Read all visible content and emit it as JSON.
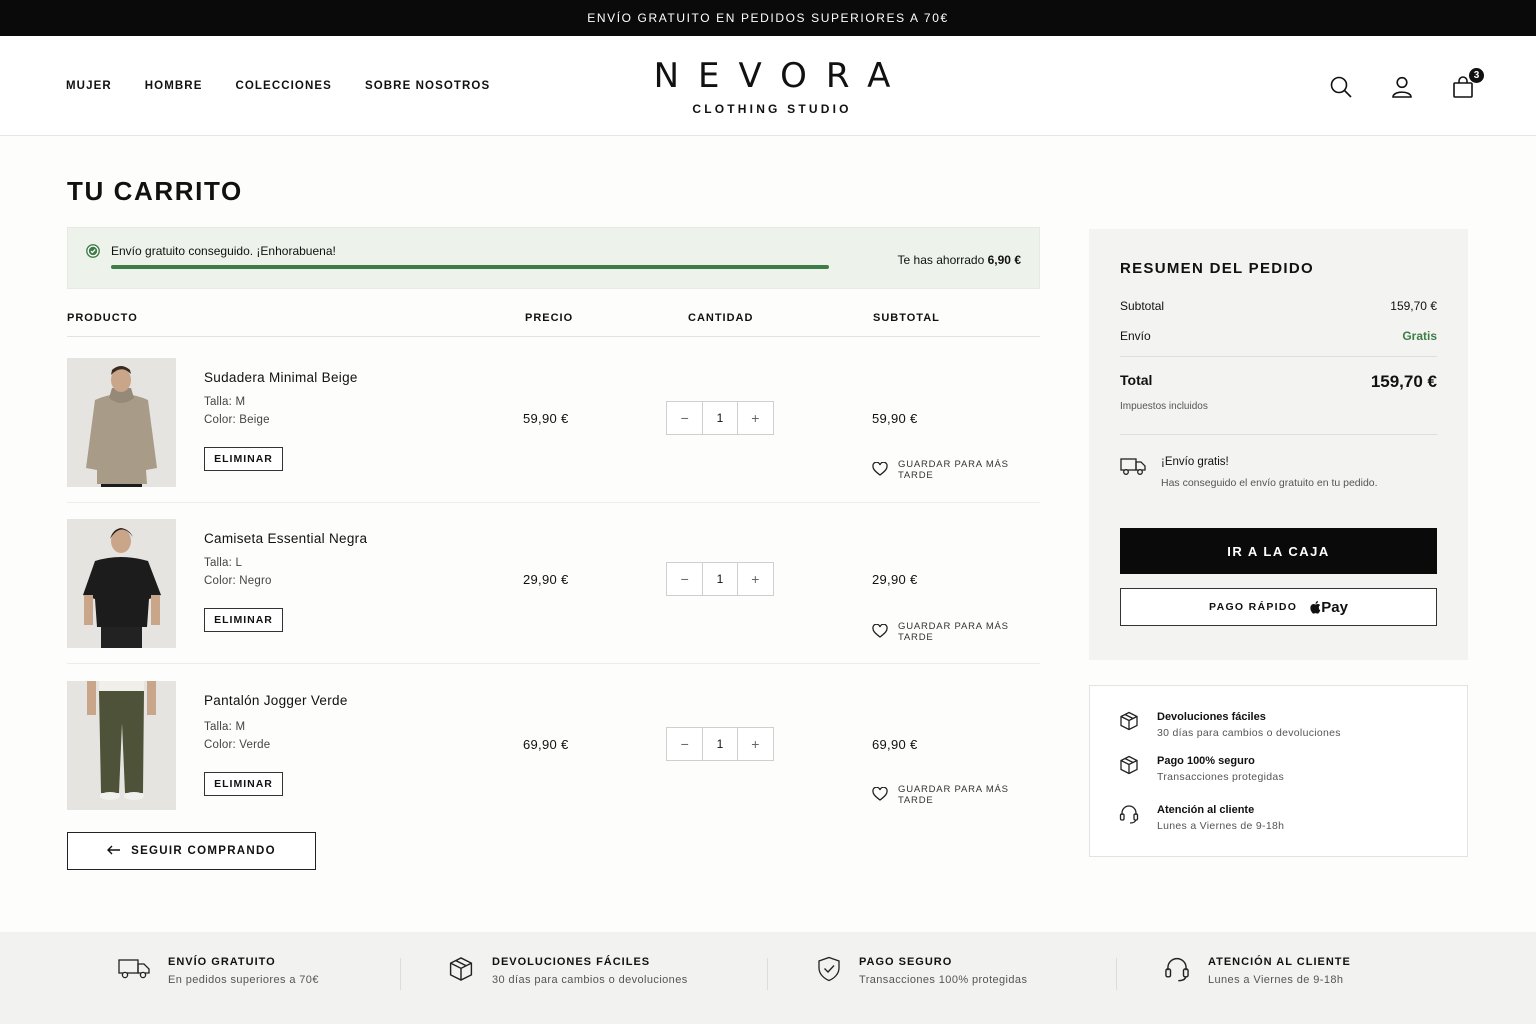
{
  "announcement": "ENVÍO GRATUITO EN PEDIDOS SUPERIORES A 70€",
  "nav": [
    "MUJER",
    "HOMBRE",
    "COLECCIONES",
    "SOBRE NOSOTROS"
  ],
  "brand": {
    "name": "NEVORA",
    "tagline": "CLOTHING STUDIO"
  },
  "header_icons": {
    "search": "search-icon",
    "account": "user-icon",
    "cart": "bag-icon",
    "cart_count": "3"
  },
  "page_title": "TU CARRITO",
  "shipping_banner": {
    "message": "Envío gratuito conseguido. ¡Enhorabuena!",
    "saved_label": "Te has ahorrado",
    "saved_amount": "6,90 €",
    "progress": 1.0
  },
  "table_headers": {
    "product": "PRODUCTO",
    "price": "PRECIO",
    "quantity": "CANTIDAD",
    "subtotal": "SUBTOTAL"
  },
  "items": [
    {
      "name": "Sudadera Minimal Beige",
      "size": "Talla: M",
      "color": "Color: Beige",
      "price": "59,90 €",
      "qty": "1",
      "subtotal": "59,90 €",
      "remove": "ELIMINAR",
      "save": "GUARDAR PARA MÁS TARDE",
      "garment": "#a89c88"
    },
    {
      "name": "Camiseta Essential Negra",
      "size": "Talla: L",
      "color": "Color: Negro",
      "price": "29,90 €",
      "qty": "1",
      "subtotal": "29,90 €",
      "remove": "ELIMINAR",
      "save": "GUARDAR PARA MÁS TARDE",
      "garment": "#1c1c1c"
    },
    {
      "name": "Pantalón Jogger Verde",
      "size": "Talla: M",
      "color": "Color: Verde",
      "price": "69,90 €",
      "qty": "1",
      "subtotal": "69,90 €",
      "remove": "ELIMINAR",
      "save": "GUARDAR PARA MÁS TARDE",
      "garment": "#4d5238"
    }
  ],
  "continue_shopping": "SEGUIR COMPRANDO",
  "summary": {
    "title": "RESUMEN DEL PEDIDO",
    "subtotal_label": "Subtotal",
    "subtotal_value": "159,70 €",
    "shipping_label": "Envío",
    "shipping_value": "Gratis",
    "total_label": "Total",
    "total_value": "159,70 €",
    "taxes_note": "Impuestos incluidos",
    "free_title": "¡Envío gratis!",
    "free_sub": "Has conseguido el envío gratuito en tu pedido.",
    "checkout": "IR A LA CAJA",
    "fast_pay": "PAGO RÁPIDO",
    "apple_pay": "Pay"
  },
  "benefits": [
    {
      "title": "Devoluciones fáciles",
      "sub": "30 días para cambios o devoluciones",
      "icon": "box-icon"
    },
    {
      "title": "Pago 100% seguro",
      "sub": "Transacciones protegidas",
      "icon": "box-icon"
    },
    {
      "title": "Atención al cliente",
      "sub": "Lunes a Viernes de 9-18h",
      "icon": "headset-icon"
    }
  ],
  "footer": [
    {
      "title": "ENVÍO GRATUITO",
      "sub": "En pedidos superiores a 70€",
      "icon": "truck-icon"
    },
    {
      "title": "DEVOLUCIONES FÁCILES",
      "sub": "30 días para cambios o devoluciones",
      "icon": "box-icon"
    },
    {
      "title": "PAGO SEGURO",
      "sub": "Transacciones 100% protegidas",
      "icon": "shield-icon"
    },
    {
      "title": "ATENCIÓN AL CLIENTE",
      "sub": "Lunes a Viernes de 9-18h",
      "icon": "headset-icon"
    }
  ],
  "colors": {
    "accent_green": "#3f7d46",
    "black": "#0a0a0a",
    "summary_bg": "#f3f3f2",
    "banner_bg": "#edf3ea"
  }
}
